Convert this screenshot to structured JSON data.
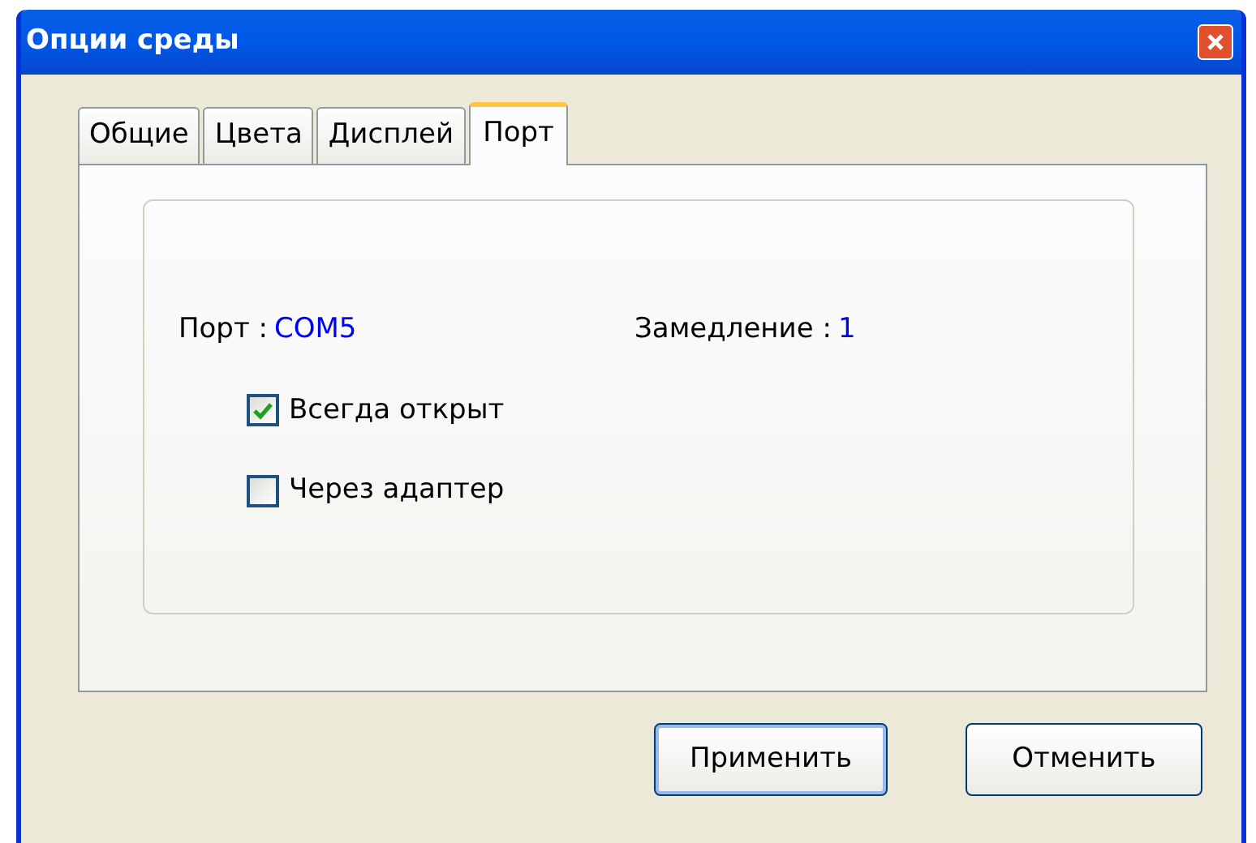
{
  "window": {
    "title": "Опции среды"
  },
  "tabs": [
    {
      "label": "Общие",
      "selected": false
    },
    {
      "label": "Цвета",
      "selected": false
    },
    {
      "label": "Дисплей",
      "selected": false
    },
    {
      "label": "Порт",
      "selected": true
    }
  ],
  "fields": [
    {
      "label": "Порт :",
      "value": "COM5"
    },
    {
      "label": "Замедление :",
      "value": "1"
    }
  ],
  "checkboxes": [
    {
      "label": "Всегда открыт",
      "checked": true
    },
    {
      "label": "Через адаптер",
      "checked": false
    }
  ],
  "buttons": [
    {
      "label": "Применить",
      "default": true
    },
    {
      "label": "Отменить",
      "default": false
    }
  ]
}
